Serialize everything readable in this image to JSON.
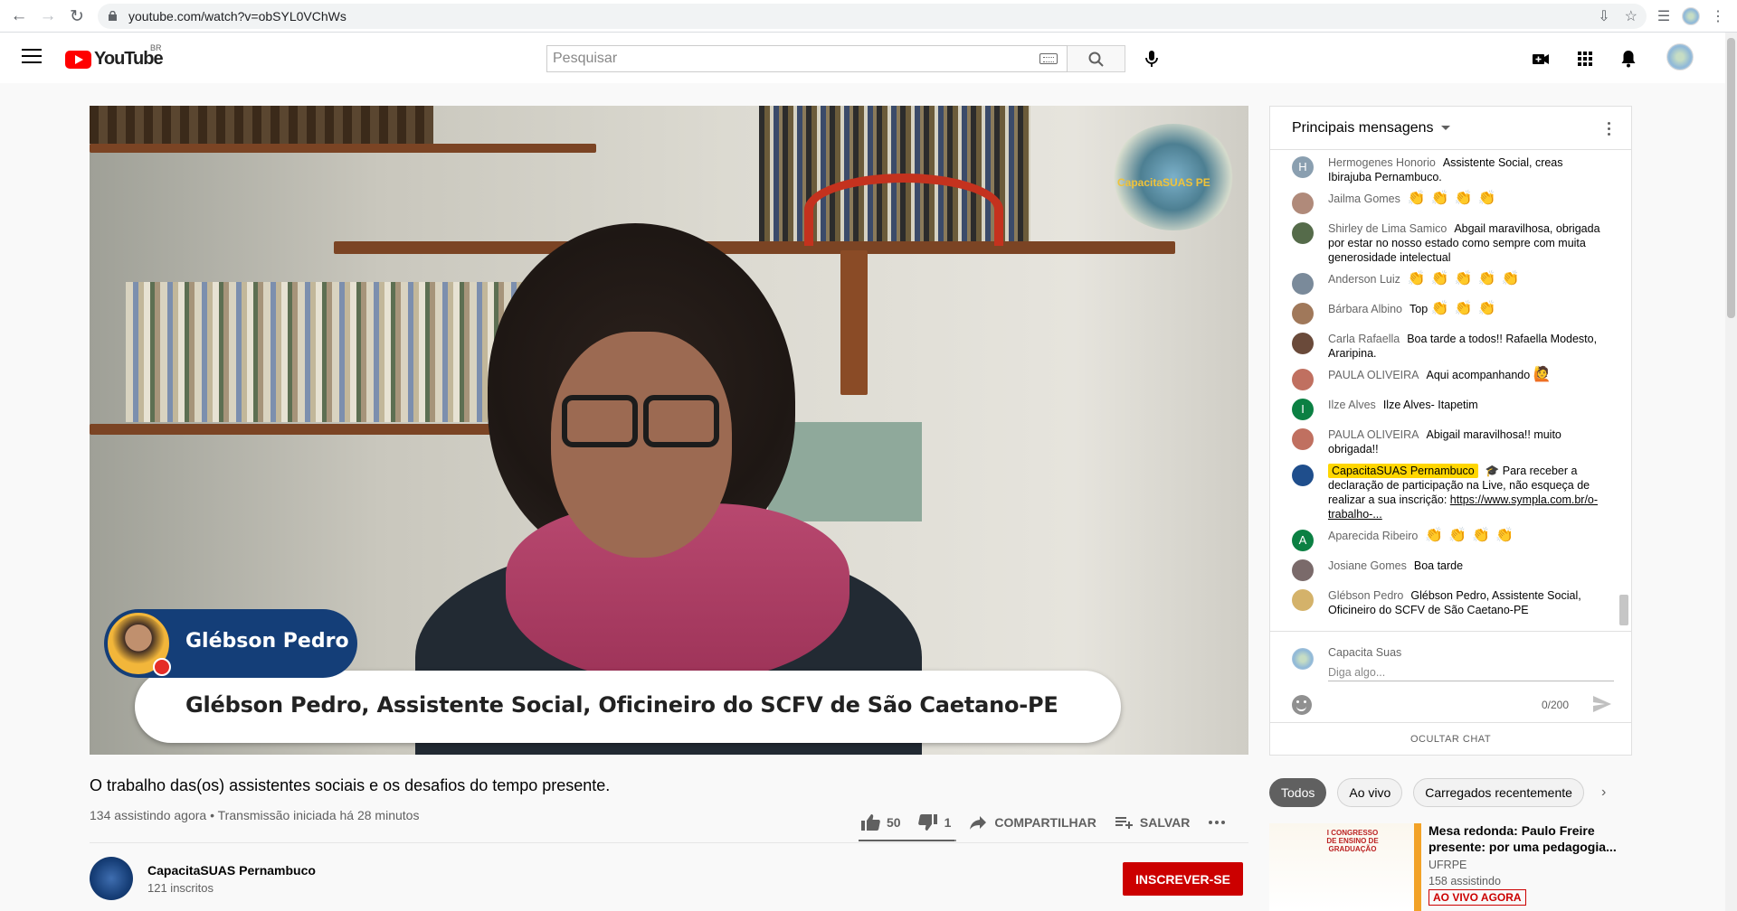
{
  "browser": {
    "url": "youtube.com/watch?v=obSYL0VChWs"
  },
  "masthead": {
    "logo_text": "YouTube",
    "country": "BR",
    "search_placeholder": "Pesquisar"
  },
  "video": {
    "lower_third_name": "Glébson Pedro",
    "lower_third_caption": "Glébson Pedro, Assistente Social, Oficineiro do SCFV de São Caetano-PE",
    "watermark_text": "CapacitaSUAS PE"
  },
  "info": {
    "title": "O trabalho das(os) assistentes sociais e os desafios do tempo presente.",
    "meta": "134 assistindo agora • Transmissão iniciada há 28 minutos",
    "likes": "50",
    "dislikes": "1",
    "share_label": "COMPARTILHAR",
    "save_label": "SALVAR",
    "like_ratio": 0.98
  },
  "channel": {
    "name": "CapacitaSUAS Pernambuco",
    "subscribers": "121 inscritos",
    "subscribe_label": "INSCREVER-SE"
  },
  "chat": {
    "header": "Principais mensagens",
    "messages": [
      {
        "author": "Hermogenes Honorio",
        "text": "Assistente Social, creas Ibirajuba Pernambuco.",
        "avatar_letter": "H",
        "avatar_color": "#8a9fb0"
      },
      {
        "author": "Jailma Gomes",
        "text": "",
        "emojis": "👏👏👏👏",
        "avatar_color": "#b08a7a"
      },
      {
        "author": "Shirley de Lima Samico",
        "text": "Abgail maravilhosa, obrigada por estar no nosso estado como sempre com muita generosidade intelectual",
        "avatar_color": "#556b4a"
      },
      {
        "author": "Anderson Luiz",
        "text": "",
        "emojis": "👏👏👏👏👏",
        "avatar_color": "#7a8a9a"
      },
      {
        "author": "Bárbara Albino",
        "text": "Top",
        "emojis": "👏👏👏",
        "avatar_color": "#a0785a"
      },
      {
        "author": "Carla Rafaella",
        "text": "Boa tarde a todos!! Rafaella Modesto, Araripina.",
        "avatar_color": "#6a4a3a"
      },
      {
        "author": "PAULA OLIVEIRA",
        "text": "Aqui acompanhando",
        "emojis": "🙋",
        "avatar_color": "#c07060"
      },
      {
        "author": "Ilze Alves",
        "text": "Ilze Alves- Itapetim",
        "avatar_letter": "I",
        "avatar_color": "#0b8043"
      },
      {
        "author": "PAULA OLIVEIRA",
        "text": "Abigail maravilhosa!! muito obrigada!!",
        "avatar_color": "#c07060"
      },
      {
        "author": "CapacitaSUAS Pernambuco",
        "owner": true,
        "text": "🎓 Para receber a declaração de participação na Live, não esqueça de realizar a sua inscrição:",
        "link": "https://www.sympla.com.br/o-trabalho-...",
        "avatar_color": "#1f4e8c"
      },
      {
        "author": "Aparecida Ribeiro",
        "text": "",
        "emojis": "👏👏👏👏",
        "avatar_letter": "A",
        "avatar_color": "#0b8043"
      },
      {
        "author": "Josiane Gomes",
        "text": "Boa tarde",
        "avatar_color": "#7a6a6a"
      },
      {
        "author": "Glébson Pedro",
        "text": "Glébson Pedro, Assistente Social, Oficineiro do SCFV de São Caetano-PE",
        "avatar_color": "#d4b26a"
      }
    ],
    "input_author": "Capacita Suas",
    "input_placeholder": "Diga algo...",
    "char_count": "0/200",
    "hide_label": "OCULTAR CHAT"
  },
  "chips": [
    "Todos",
    "Ao vivo",
    "Carregados recentemente"
  ],
  "recommendation": {
    "title": "Mesa redonda: Paulo Freire presente: por uma pedagogia...",
    "channel": "UFRPE",
    "views": "158 assistindo",
    "live_badge": "AO VIVO AGORA",
    "thumb_text": "I CONGRESSO DE ENSINO DE GRADUAÇÃO"
  },
  "colors": {
    "accent_red": "#cc0000",
    "owner_badge": "#ffd600",
    "lower_third_blue": "#143e78"
  }
}
